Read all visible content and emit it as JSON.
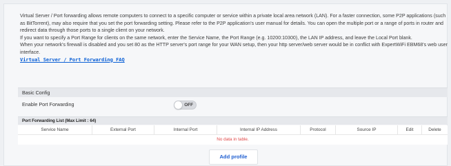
{
  "description": {
    "lines": [
      "Virtual Server / Port forwarding allows remote computers to connect to a specific computer or service within a private local area network (LAN). For a faster connection, some P2P applications (such as BitTorrent), may also require that you set the port forwarding setting. Please refer to the P2P application's user manual for details. You can open the multiple port or a range of ports in router and redirect data through those ports to a single client on your network.",
      "If you want to specify a Port Range for clients on the same network, enter the Service Name, the Port Range (e.g. 10200:10300), the LAN IP address, and leave the Local Port blank.",
      "When your network's firewall is disabled and you set 80 as the HTTP server's port range for your WAN setup, then your http server/web server would be in conflict with ExpertWiFi EBM68's web user interface."
    ],
    "faq_link": "Virtual Server / Port Forwarding FAQ"
  },
  "basic_config": {
    "title": "Basic Config",
    "enable_label": "Enable Port Forwarding",
    "toggle_state": "OFF"
  },
  "port_list": {
    "title": "Port Forwarding List (Max Limit : 64)",
    "columns": [
      "Service Name",
      "External Port",
      "Internal Port",
      "Internal IP Address",
      "Protocol",
      "Source IP",
      "Edit",
      "Delete"
    ],
    "empty_message": "No data in table."
  },
  "add_profile_label": "Add profile",
  "colors": {
    "link": "#0a5fd6",
    "empty_message": "#e04848",
    "button_text": "#1f5fd1"
  }
}
